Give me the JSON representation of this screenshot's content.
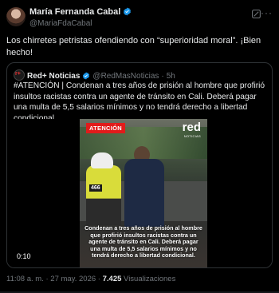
{
  "author": {
    "name": "María Fernanda Cabal",
    "handle": "@MariaFdaCabal"
  },
  "tweet": {
    "text": "Los chirretes petristas ofendiendo con “superioridad moral”. ¡Bien hecho!"
  },
  "quoted": {
    "name": "Red+ Noticias",
    "handle": "@RedMasNoticias",
    "separator": "·",
    "age": "5h",
    "text": "#ATENCIÓN | Condenan a tres años de prisión al hombre que profirió insultos racistas contra un agente de tránsito en Cali. Deberá pagar una multa de 5,5 salarios mínimos y no tendrá derecho a libertad condicional.",
    "video": {
      "badge": "ATENCIÓN",
      "logo": "red",
      "logo_sub": "NOTICIAS",
      "unit_number": "466",
      "caption": "Condenan a tres años de prisión al hombre que profirió insultos racistas contra un agente de tránsito en Cali. Deberá pagar una multa de 5,5 salarios mínimos y no tendrá derecho a libertad condicional.",
      "duration": "0:10"
    }
  },
  "meta": {
    "time": "11:08 a. m.",
    "dot": "·",
    "date": "27 may. 2026",
    "views_count": "7.425",
    "views_label": "Visualizaciones"
  },
  "colors": {
    "background": "#000000",
    "verified": "#1d9bf0",
    "accent_red": "#e11b1b"
  },
  "icons": [
    "verified-icon",
    "grok-icon",
    "more-icon"
  ]
}
